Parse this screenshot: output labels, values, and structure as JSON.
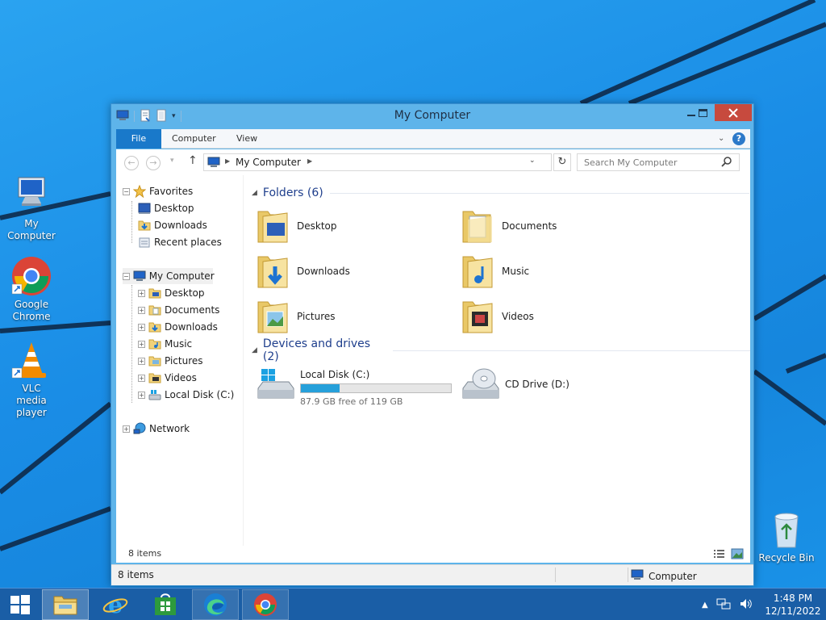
{
  "desktop": {
    "icons": [
      {
        "label": "My Computer",
        "icon": "computer-icon"
      },
      {
        "label": "Google Chrome",
        "icon": "chrome-icon"
      },
      {
        "label": "VLC media player",
        "icon": "vlc-icon"
      },
      {
        "label": "Recycle Bin",
        "icon": "recycle-bin-icon"
      }
    ]
  },
  "window": {
    "title": "My Computer",
    "ribbon": {
      "file": "File",
      "computer": "Computer",
      "view": "View",
      "help": "?"
    },
    "address": {
      "path": "My Computer"
    },
    "search": {
      "placeholder": "Search My Computer"
    },
    "nav": {
      "favorites": {
        "label": "Favorites",
        "items": [
          "Desktop",
          "Downloads",
          "Recent places"
        ]
      },
      "computer": {
        "label": "My Computer",
        "items": [
          "Desktop",
          "Documents",
          "Downloads",
          "Music",
          "Pictures",
          "Videos",
          "Local Disk (C:)"
        ]
      },
      "network": {
        "label": "Network"
      }
    },
    "folders": {
      "header": "Folders (6)",
      "items": [
        "Desktop",
        "Documents",
        "Downloads",
        "Music",
        "Pictures",
        "Videos"
      ]
    },
    "drives": {
      "header": "Devices and drives (2)",
      "local": {
        "label": "Local Disk (C:)",
        "free_text": "87.9 GB free of 119 GB",
        "used_fraction": 0.26
      },
      "cd": {
        "label": "CD Drive (D:)"
      }
    },
    "status": {
      "count_inner": "8 items",
      "count": "8 items",
      "zone": "Computer"
    }
  },
  "taskbar": {
    "apps": [
      "start",
      "file-explorer",
      "internet-explorer",
      "store",
      "edge",
      "chrome"
    ],
    "time": "1:48 PM",
    "date": "12/11/2022"
  },
  "colors": {
    "accent": "#1979ca",
    "close": "#c74a3e",
    "titlebar": "#5eb4ea",
    "taskbar": "#1a5ea6",
    "header_text": "#1e3e8c"
  }
}
